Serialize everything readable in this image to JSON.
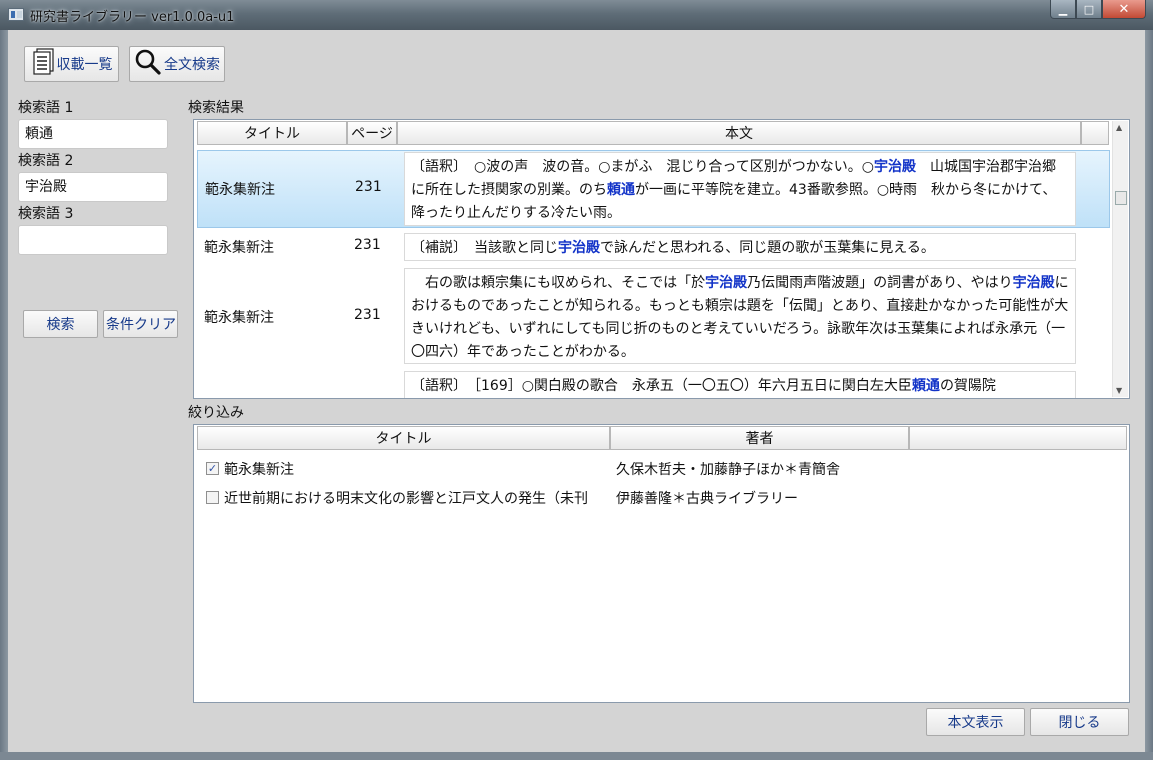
{
  "window": {
    "title": "研究書ライブラリー ver1.0.0a-u1",
    "min_icon": "minimize-icon",
    "max_icon": "maximize-icon",
    "close_icon": "close-icon"
  },
  "toolbar": {
    "list_label": "収載一覧",
    "fulltext_label": "全文検索"
  },
  "search": {
    "term1_label": "検索語 1",
    "term1_value": "頼通",
    "term2_label": "検索語 2",
    "term2_value": "宇治殿",
    "term3_label": "検索語 3",
    "term3_value": "",
    "search_button": "検索",
    "clear_button": "条件クリア"
  },
  "results": {
    "section_label": "検索結果",
    "columns": [
      "タイトル",
      "ページ",
      "本文"
    ],
    "rows": [
      {
        "title": "範永集新注",
        "page": "231",
        "text": "〔語釈〕　○波の声　波の音。○まがふ　混じり合って区別がつかない。○宇治殿　山城国宇治郡宇治郷に所在した摂関家の別業。のち頼通が一画に平等院を建立。43番歌参照。○時雨　秋から冬にかけて、降ったり止んだりする冷たい雨。"
      },
      {
        "title": "範永集新注",
        "page": "231",
        "text": "〔補説〕　当該歌と同じ宇治殿で詠んだと思われる、同じ題の歌が玉葉集に見える。"
      },
      {
        "title": "範永集新注",
        "page": "231",
        "text": "　右の歌は頼宗集にも収められ、そこでは「於宇治殿乃伝聞雨声階波題」の詞書があり、やはり宇治殿におけるものであったことが知られる。もっとも頼宗は題を「伝聞」とあり、直接赴かなかった可能性が大きいけれども、いずれにしても同じ折のものと考えていいだろう。詠歌年次は玉葉集によれば永承元（一〇四六）年であったことがわかる。"
      },
      {
        "title": "",
        "page": "",
        "text": "〔語釈〕　［169］○関白殿の歌合　永承五（一〇五〇）年六月五日に関白左大臣頼通の賀陽院"
      }
    ]
  },
  "filter": {
    "section_label": "絞り込み",
    "columns": [
      "タイトル",
      "著者",
      ""
    ],
    "rows": [
      {
        "checked": true,
        "title": "範永集新注",
        "author": "久保木哲夫・加藤静子ほか＊青簡舎"
      },
      {
        "checked": false,
        "title": "近世前期における明末文化の影響と江戸文人の発生（未刊",
        "author": "伊藤善隆＊古典ライブラリー"
      }
    ]
  },
  "footer": {
    "show_text_button": "本文表示",
    "close_button": "閉じる"
  },
  "colors": {
    "highlight": "#1233c8",
    "selected_row": "#cfe8fa",
    "button_text": "#173a8a"
  }
}
